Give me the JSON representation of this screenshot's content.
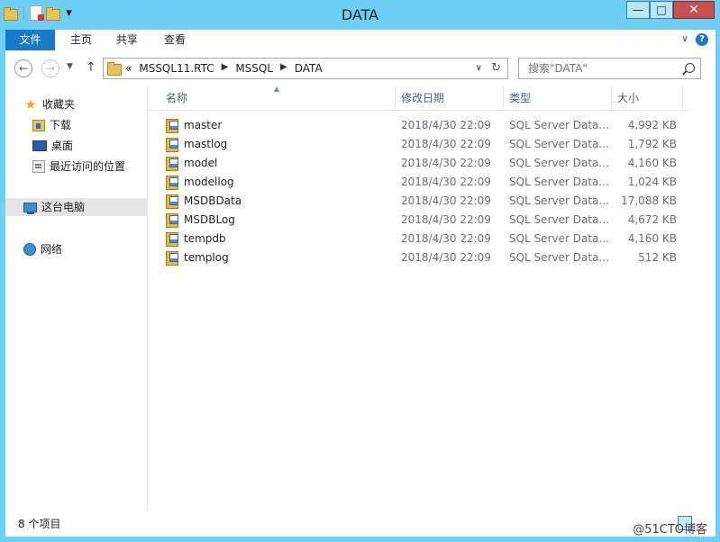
{
  "window": {
    "title": "DATA",
    "controls": {
      "minimize": "—",
      "maximize": "□",
      "close": "✕"
    }
  },
  "ribbon": {
    "tabs": [
      "文件",
      "主页",
      "共享",
      "查看"
    ],
    "help": "?",
    "collapse": "∨"
  },
  "nav": {
    "back": "←",
    "forward": "→",
    "up": "↑",
    "breadcrumb": [
      "«",
      "MSSQL11.RTC",
      "MSSQL",
      "DATA"
    ],
    "refresh": "↻"
  },
  "search": {
    "placeholder": "搜索\"DATA\""
  },
  "sidebar": {
    "favorites": "收藏夹",
    "items": [
      "下载",
      "桌面",
      "最近访问的位置"
    ],
    "this_pc": "这台电脑",
    "network": "网络"
  },
  "columns": {
    "name": "名称",
    "date": "修改日期",
    "type": "类型",
    "size": "大小"
  },
  "files": [
    {
      "name": "master",
      "date": "2018/4/30 22:09",
      "type": "SQL Server Data...",
      "size": "4,992 KB"
    },
    {
      "name": "mastlog",
      "date": "2018/4/30 22:09",
      "type": "SQL Server Data...",
      "size": "1,792 KB"
    },
    {
      "name": "model",
      "date": "2018/4/30 22:09",
      "type": "SQL Server Data...",
      "size": "4,160 KB"
    },
    {
      "name": "modellog",
      "date": "2018/4/30 22:09",
      "type": "SQL Server Data...",
      "size": "1,024 KB"
    },
    {
      "name": "MSDBData",
      "date": "2018/4/30 22:09",
      "type": "SQL Server Data...",
      "size": "17,088 KB"
    },
    {
      "name": "MSDBLog",
      "date": "2018/4/30 22:09",
      "type": "SQL Server Data...",
      "size": "4,672 KB"
    },
    {
      "name": "tempdb",
      "date": "2018/4/30 22:09",
      "type": "SQL Server Data...",
      "size": "4,160 KB"
    },
    {
      "name": "templog",
      "date": "2018/4/30 22:09",
      "type": "SQL Server Data...",
      "size": "512 KB"
    }
  ],
  "status": {
    "count": "8 个项目"
  },
  "watermark": "@51CTO博客",
  "colors": {
    "frame": "#6dcff6",
    "file_tab": "#1979ca",
    "close": "#c75050"
  }
}
